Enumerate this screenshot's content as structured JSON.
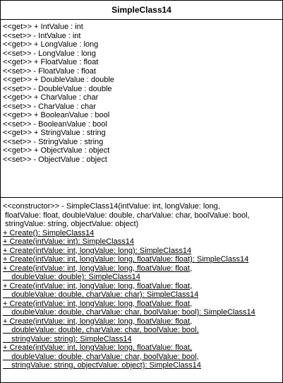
{
  "class_name": "SimpleClass14",
  "attributes": [
    "<<get>> + IntValue : int",
    "<<set>> - IntValue : int",
    "<<get>> + LongValue : long",
    "<<set>> - LongValue : long",
    "<<get>> + FloatValue : float",
    "<<set>> - FloatValue : float",
    "<<get>> + DoubleValue : double",
    "<<set>> - DoubleValue : double",
    "<<get>> + CharValue : char",
    "<<set>> - CharValue : char",
    "<<get>> + BooleanValue : bool",
    "<<set>> - BooleanValue : bool",
    "<<get>> + StringValue : string",
    "<<set>> - StringValue : string",
    "<<get>> + ObjectValue : object",
    "<<set>> - ObjectValue : object"
  ],
  "operations": [
    {
      "underline": false,
      "lines": [
        "<<constructor>> - SimpleClass14(intValue: int, longValue: long,",
        " floatValue: float, doubleValue: double, charValue: char, boolValue: bool,",
        " stringValue: string, objectValue: object)"
      ]
    },
    {
      "underline": true,
      "lines": [
        "+ Create(): SimpleClass14"
      ]
    },
    {
      "underline": true,
      "lines": [
        "+ Create(intValue: int): SimpleClass14"
      ]
    },
    {
      "underline": true,
      "lines": [
        "+ Create(intValue: int, longValue: long): SimpleClass14"
      ]
    },
    {
      "underline": true,
      "lines": [
        "+ Create(intValue: int, longValue: long, floatValue: float): SimpleClass14"
      ]
    },
    {
      "underline": true,
      "lines": [
        "+ Create(intValue: int, longValue: long, floatValue: float,",
        "    doubleValue: double): SimpleClass14"
      ]
    },
    {
      "underline": true,
      "lines": [
        "+ Create(intValue: int, longValue: long, floatValue: float,",
        "    doubleValue: double, charValue: char): SimpleClass14"
      ]
    },
    {
      "underline": true,
      "lines": [
        "+ Create(intValue: int, longValue: long, floatValue: float,",
        "    doubleValue: double, charValue: char, boolValue: bool): SimpleClass14"
      ]
    },
    {
      "underline": true,
      "lines": [
        "+ Create(intValue: int, longValue: long, floatValue: float,",
        "    doubleValue: double, charValue: char, boolValue: bool,",
        "    stringValue: string): SimpleClass14"
      ]
    },
    {
      "underline": true,
      "lines": [
        "+ Create(intValue: int, longValue: long, floatValue: float,",
        "    doubleValue: double, charValue: char, boolValue: bool,",
        "    stringValue: string, objectValue: object): SimpleClass14"
      ]
    }
  ]
}
